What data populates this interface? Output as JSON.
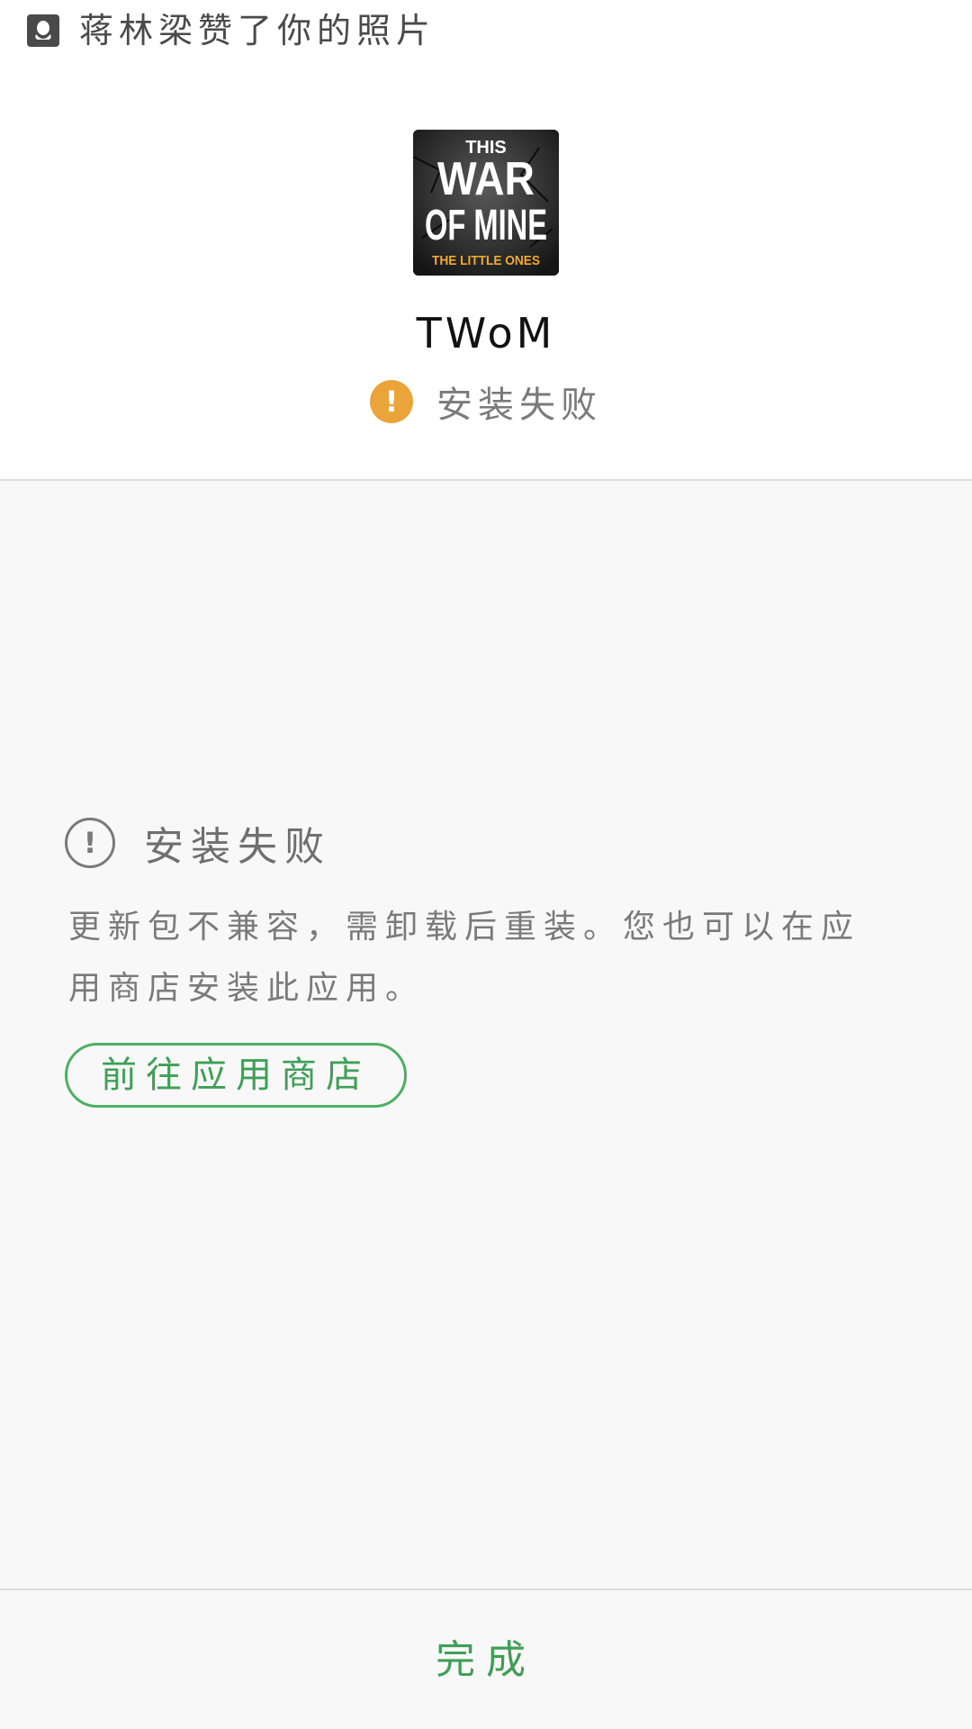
{
  "notification": {
    "icon": "qq-penguin-icon",
    "text": "蒋林梁赞了你的照片"
  },
  "app": {
    "icon_title": [
      "THIS",
      "WAR",
      "OF MINE"
    ],
    "icon_subtitle": "THE LITTLE ONES",
    "name": "TWoM",
    "status": "安装失败",
    "status_color": "#eba43a"
  },
  "details": {
    "title": "安装失败",
    "description": "更新包不兼容，需卸载后重装。您也可以在应用商店安装此应用。",
    "store_button": "前往应用商店"
  },
  "footer": {
    "done_label": "完成",
    "accent_color": "#3f9f56"
  }
}
